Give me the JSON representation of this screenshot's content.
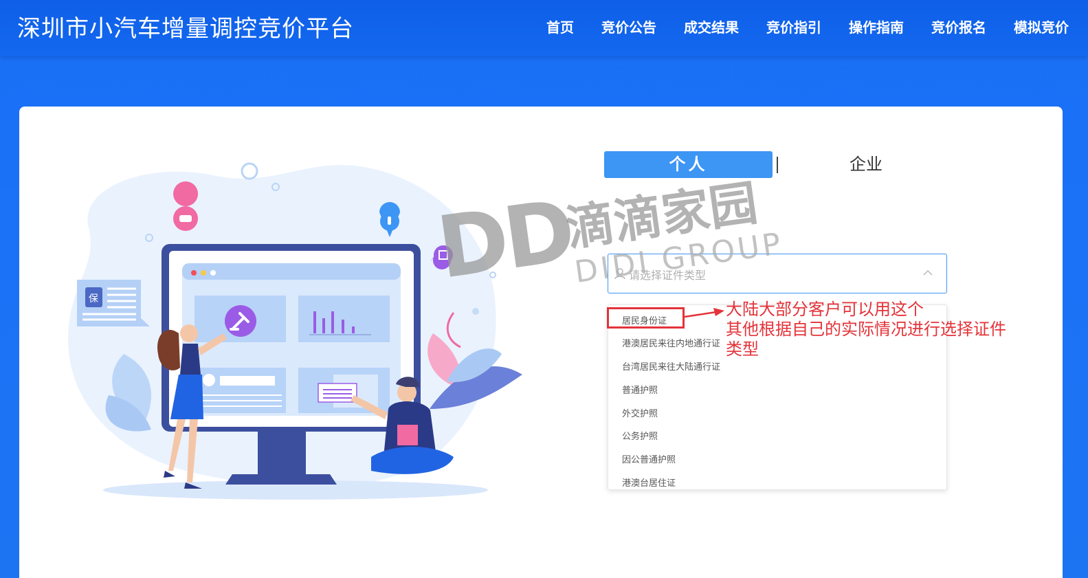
{
  "header": {
    "site_title": "深圳市小汽车增量调控竞价平台",
    "nav": [
      "首页",
      "竞价公告",
      "成交结果",
      "竞价指引",
      "操作指南",
      "竞价报名",
      "模拟竞价"
    ]
  },
  "tabs": {
    "person": "个人",
    "company": "企业",
    "active": "个人"
  },
  "cert_select": {
    "placeholder": "请选择证件类型",
    "options": [
      "居民身份证",
      "港澳居民来往内地通行证",
      "台湾居民来往大陆通行证",
      "普通护照",
      "外交护照",
      "公务护照",
      "因公普通护照",
      "港澳台居住证"
    ]
  },
  "annotation": {
    "line1": "大陆大部分客户可以用这个",
    "line2": "其他根据自己的实际情况进行选择证件",
    "line3": "类型",
    "color": "#e3333a"
  },
  "watermark": {
    "logo": "DD",
    "cn": "滴滴家园",
    "en": "DIDI GROUP"
  },
  "illustration": {
    "shield_label": "保"
  },
  "colors": {
    "primary": "#3d95f4",
    "background": "#1b72f6"
  }
}
